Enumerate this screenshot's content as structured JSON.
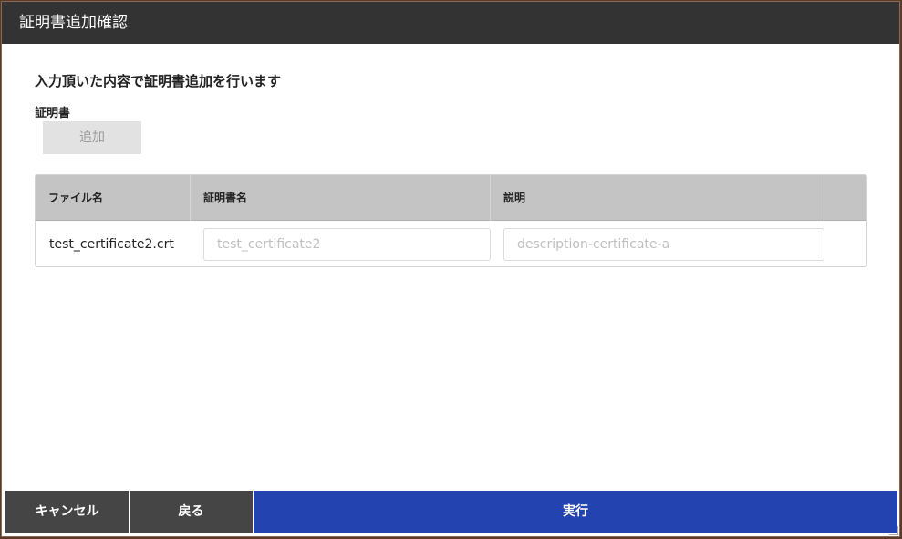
{
  "dialog": {
    "title": "証明書追加確認",
    "heading": "入力頂いた内容で証明書追加を行います",
    "certificate_label": "証明書",
    "add_button": "追加"
  },
  "table": {
    "columns": [
      "ファイル名",
      "証明書名",
      "説明",
      ""
    ],
    "rows": [
      {
        "file_name": "test_certificate2.crt",
        "cert_name_placeholder": "test_certificate2",
        "description_placeholder": "description-certificate-a"
      }
    ]
  },
  "footer": {
    "cancel": "キャンセル",
    "back": "戻る",
    "run": "実行"
  },
  "colors": {
    "titlebar": "#333333",
    "primary": "#2243b0",
    "secondary": "#454545"
  }
}
